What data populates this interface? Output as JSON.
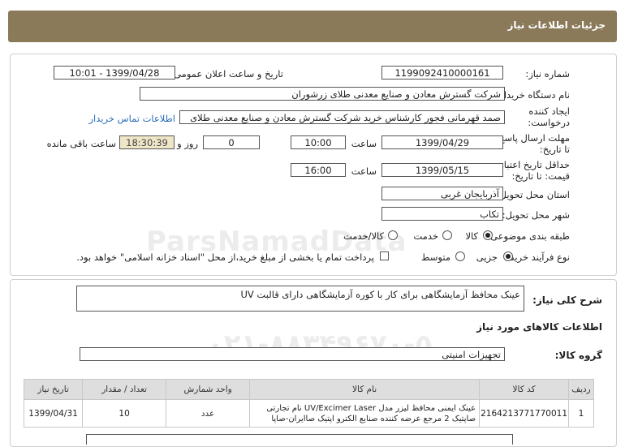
{
  "header": {
    "title": "جزئیات اطلاعات نیاز"
  },
  "form": {
    "need_number_label": "شماره نیاز:",
    "need_number": "1199092410000161",
    "announce_label": "تاریخ و ساعت اعلان عمومی:",
    "announce_value": "1399/04/28 - 10:01",
    "buyer_label": "نام دستگاه خریدار:",
    "buyer_value": "شرکت گسترش معادن و صنایع معدنی طلای زرشوران",
    "creator_label_1": "ایجاد کننده",
    "creator_label_2": "درخواست:",
    "creator_value": "صمد قهرمانی فجور کارشناس خرید شرکت گسترش معادن و صنایع معدنی طلای",
    "contact_link": "اطلاعات تماس خریدار",
    "deadline_label_1": "مهلت ارسال پاسخ:",
    "deadline_label_2": "تا تاریخ:",
    "deadline_date": "1399/04/29",
    "time_label": "ساعت",
    "deadline_time": "10:00",
    "day_count": "0",
    "day_and_label": "روز و",
    "remaining_time": "18:30:39",
    "remaining_label": "ساعت باقی مانده",
    "validity_label_1": "حداقل تاریخ اعتبار",
    "validity_label_2": "قیمت: تا تاریخ:",
    "validity_date": "1399/05/15",
    "validity_time": "16:00",
    "province_label": "استان محل تحویل:",
    "province_value": "آذربایجان غربی",
    "city_label": "شهر محل تحویل:",
    "city_value": "تکاب",
    "category_label": "طبقه بندی موضوعی:",
    "category_options": [
      "کالا",
      "خدمت",
      "کالا/خدمت"
    ],
    "category_selected": "کالا",
    "process_label": "نوع فرآیند خرید :",
    "process_options": [
      "جزیی",
      "متوسط"
    ],
    "process_selected": "جزیی",
    "payment_note": "پرداخت تمام یا بخشی از مبلغ خرید،از محل \"اسناد خزانه اسلامی\" خواهد بود."
  },
  "watermark": "ParsNamadData",
  "details": {
    "description_label": "شرح کلی نیاز:",
    "description_value": "عینک محافظ آزمایشگاهی برای کار با کوره آزمایشگاهی دارای قالبت UV",
    "goods_info_title": "اطلاعات کالاهای مورد نیاز",
    "goods_group_label": "گروه کالا:",
    "goods_group_value": "تجهیزات امنیتی"
  },
  "table": {
    "headers": [
      "ردیف",
      "کد کالا",
      "نام کالا",
      "واحد شمارش",
      "تعداد / مقدار",
      "تاریخ نیاز"
    ],
    "rows": [
      {
        "index": "1",
        "code": "2164213771770011",
        "name_line1": "عینک ایمنی محافظ لیزر مدل UV/Excimer Laser نام تجارتی",
        "name_line2": "صاپتیک 2 مرجع عرضه کننده صنایع الکترو اپتیک صاایران-صاپا",
        "unit": "عدد",
        "qty": "10",
        "date": "1399/04/31"
      }
    ]
  }
}
